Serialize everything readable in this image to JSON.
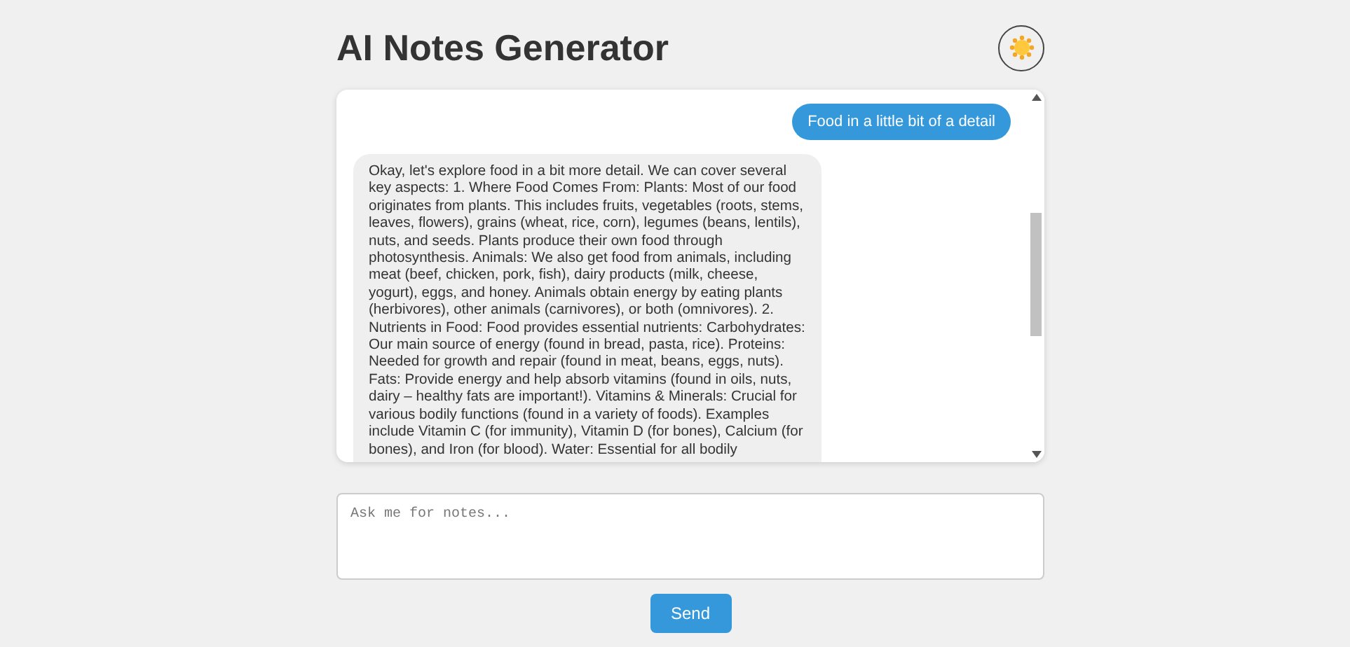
{
  "header": {
    "title": "AI Notes Generator"
  },
  "messages": [
    {
      "kind": "user",
      "text": "Food in a little bit of a detail"
    },
    {
      "kind": "bot",
      "text": "Okay, let's explore food in a bit more detail. We can cover several key aspects: 1. Where Food Comes From: Plants: Most of our food originates from plants. This includes fruits, vegetables (roots, stems, leaves, flowers), grains (wheat, rice, corn), legumes (beans, lentils), nuts, and seeds. Plants produce their own food through photosynthesis. Animals: We also get food from animals, including meat (beef, chicken, pork, fish), dairy products (milk, cheese, yogurt), eggs, and honey. Animals obtain energy by eating plants (herbivores), other animals (carnivores), or both (omnivores). 2. Nutrients in Food: Food provides essential nutrients: Carbohydrates: Our main source of energy (found in bread, pasta, rice). Proteins: Needed for growth and repair (found in meat, beans, eggs, nuts). Fats: Provide energy and help absorb vitamins (found in oils, nuts, dairy – healthy fats are important!). Vitamins & Minerals: Crucial for various bodily functions (found in a variety of foods). Examples include Vitamin C (for immunity), Vitamin D (for bones), Calcium (for bones), and Iron (for blood). Water: Essential for all bodily"
    }
  ],
  "input": {
    "placeholder": "Ask me for notes..."
  },
  "send_button": {
    "label": "Send"
  }
}
